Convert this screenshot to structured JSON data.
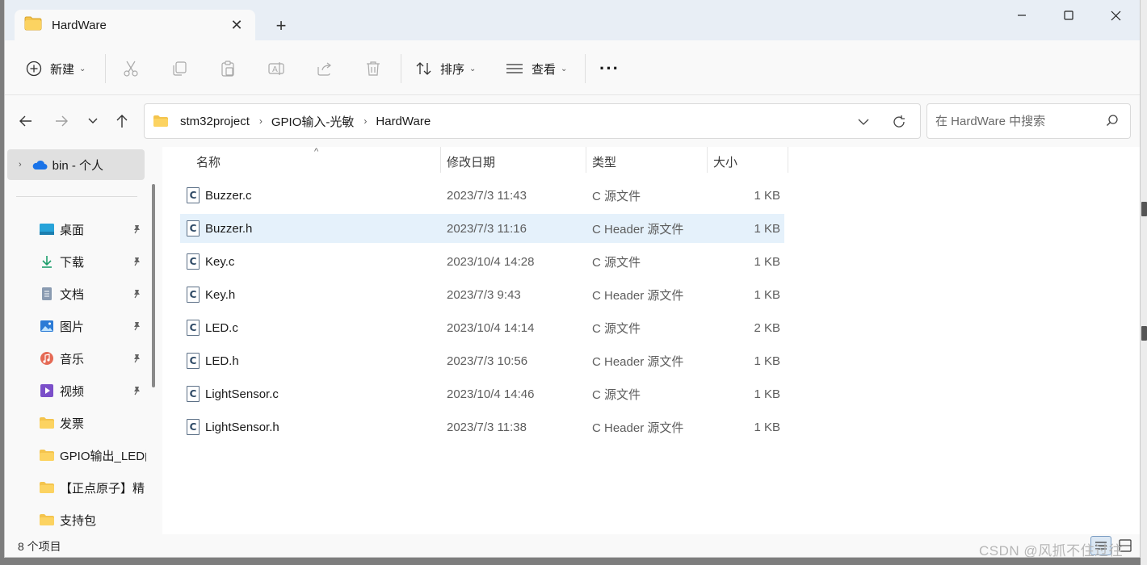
{
  "window": {
    "tab_title": "HardWare",
    "tab_close": "✕",
    "new_tab": "+"
  },
  "toolbar": {
    "new_label": "新建",
    "sort_label": "排序",
    "view_label": "查看",
    "more_label": "···",
    "icons": [
      "plus-circle-icon",
      "cut-icon",
      "copy-icon",
      "paste-icon",
      "rename-icon",
      "share-icon",
      "delete-icon",
      "sort-icon",
      "view-icon",
      "more-icon"
    ]
  },
  "address": {
    "breadcrumbs": [
      "stm32project",
      "GPIO输入-光敏",
      "HardWare"
    ],
    "search_placeholder": "在 HardWare 中搜索"
  },
  "sidebar": {
    "root_label": "bin - 个人",
    "items": [
      {
        "label": "桌面",
        "icon": "desktop-icon",
        "pinned": true
      },
      {
        "label": "下载",
        "icon": "download-icon",
        "pinned": true
      },
      {
        "label": "文档",
        "icon": "document-icon",
        "pinned": true
      },
      {
        "label": "图片",
        "icon": "pictures-icon",
        "pinned": true
      },
      {
        "label": "音乐",
        "icon": "music-icon",
        "pinned": true
      },
      {
        "label": "视频",
        "icon": "video-icon",
        "pinned": true
      },
      {
        "label": "发票",
        "icon": "folder-icon",
        "pinned": false
      },
      {
        "label": "GPIO输出_LED闪",
        "icon": "folder-icon",
        "pinned": false
      },
      {
        "label": "【正点原子】精",
        "icon": "folder-icon",
        "pinned": false
      },
      {
        "label": "支持包",
        "icon": "folder-icon",
        "pinned": false
      }
    ]
  },
  "columns": {
    "name": "名称",
    "date": "修改日期",
    "type": "类型",
    "size": "大小"
  },
  "files": [
    {
      "name": "Buzzer.c",
      "date": "2023/7/3 11:43",
      "type": "C 源文件",
      "size": "1 KB"
    },
    {
      "name": "Buzzer.h",
      "date": "2023/7/3 11:16",
      "type": "C Header 源文件",
      "size": "1 KB"
    },
    {
      "name": "Key.c",
      "date": "2023/10/4 14:28",
      "type": "C 源文件",
      "size": "1 KB"
    },
    {
      "name": "Key.h",
      "date": "2023/7/3 9:43",
      "type": "C Header 源文件",
      "size": "1 KB"
    },
    {
      "name": "LED.c",
      "date": "2023/10/4 14:14",
      "type": "C 源文件",
      "size": "2 KB"
    },
    {
      "name": "LED.h",
      "date": "2023/7/3 10:56",
      "type": "C Header 源文件",
      "size": "1 KB"
    },
    {
      "name": "LightSensor.c",
      "date": "2023/10/4 14:46",
      "type": "C 源文件",
      "size": "1 KB"
    },
    {
      "name": "LightSensor.h",
      "date": "2023/7/3 11:38",
      "type": "C Header 源文件",
      "size": "1 KB"
    }
  ],
  "selected_file": "Buzzer.h",
  "status": {
    "item_count": "8 个项目"
  },
  "watermark": "CSDN @风抓不住过往",
  "colors": {
    "accent": "#0067c0",
    "selection": "#e5f1fb",
    "folder": "#f4c44d"
  }
}
